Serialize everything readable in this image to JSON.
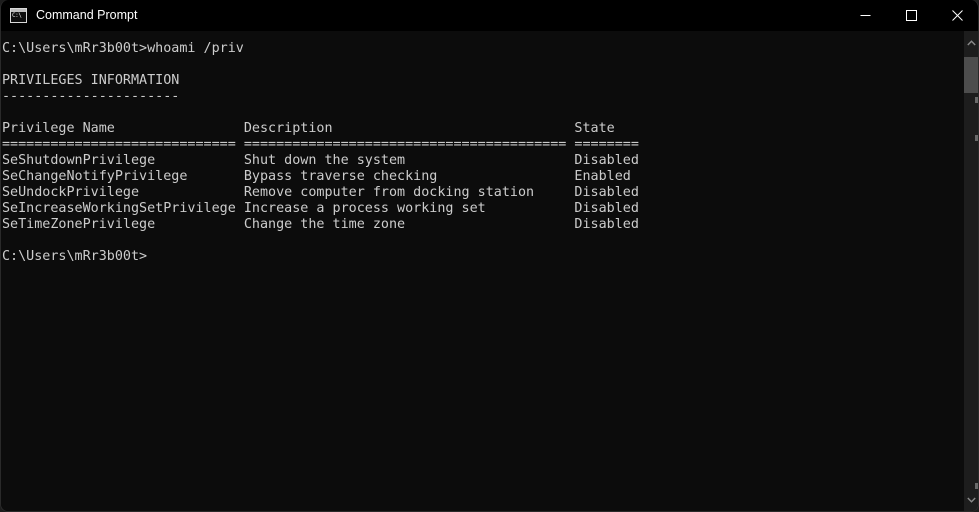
{
  "window": {
    "title": "Command Prompt",
    "icon_name": "command-prompt-icon",
    "icon_glyph": "C:\\",
    "background_color": "#0c0c0c",
    "titlebar_color": "#000000",
    "text_color": "#cccccc"
  },
  "window_controls": {
    "minimize_label": "Minimize",
    "maximize_label": "Maximize",
    "close_label": "Close"
  },
  "scrollbar": {
    "up_arrow_label": "Scroll up",
    "down_arrow_label": "Scroll down",
    "thumb_label": "Scroll thumb"
  },
  "console": {
    "prompt": "C:\\Users\\mRr3b00t>",
    "command": "whoami /priv",
    "section_title": "PRIVILEGES INFORMATION",
    "section_underline": "----------------------",
    "columns": [
      "Privilege Name",
      "Description",
      "State"
    ],
    "column_rules": [
      "==============================",
      "========================================",
      "========"
    ],
    "rows": [
      {
        "name": "SeShutdownPrivilege",
        "description": "Shut down the system",
        "state": "Disabled"
      },
      {
        "name": "SeChangeNotifyPrivilege",
        "description": "Bypass traverse checking",
        "state": "Enabled"
      },
      {
        "name": "SeUndockPrivilege",
        "description": "Remove computer from docking station",
        "state": "Disabled"
      },
      {
        "name": "SeIncreaseWorkingSetPrivilege",
        "description": "Increase a process working set",
        "state": "Disabled"
      },
      {
        "name": "SeTimeZonePrivilege",
        "description": "Change the time zone",
        "state": "Disabled"
      }
    ],
    "final_prompt": "C:\\Users\\mRr3b00t>",
    "text": "C:\\Users\\mRr3b00t>whoami /priv\n\nPRIVILEGES INFORMATION\n----------------------\n\nPrivilege Name                Description                              State\n============================= ======================================== ========\nSeShutdownPrivilege           Shut down the system                     Disabled\nSeChangeNotifyPrivilege       Bypass traverse checking                 Enabled\nSeUndockPrivilege             Remove computer from docking station     Disabled\nSeIncreaseWorkingSetPrivilege Increase a process working set           Disabled\nSeTimeZonePrivilege           Change the time zone                     Disabled\n\nC:\\Users\\mRr3b00t>"
  }
}
